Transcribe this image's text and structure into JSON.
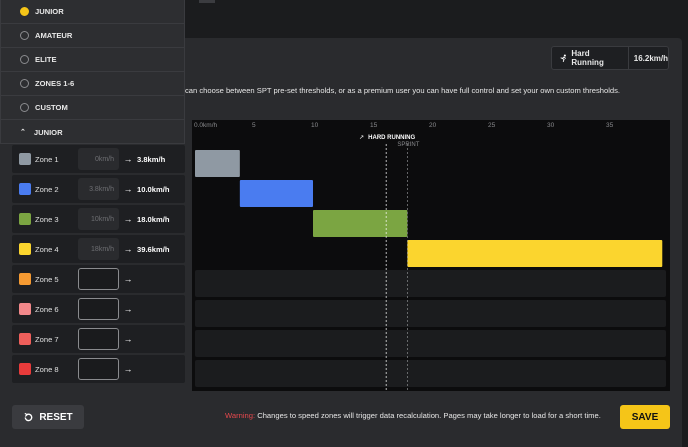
{
  "level_dropdown": {
    "options": [
      {
        "label": "JUNIOR",
        "selected": true
      },
      {
        "label": "AMATEUR",
        "selected": false
      },
      {
        "label": "ELITE",
        "selected": false
      },
      {
        "label": "ZONES 1-6",
        "selected": false
      },
      {
        "label": "CUSTOM",
        "selected": false
      }
    ],
    "current": "JUNIOR"
  },
  "hard_running": {
    "label": "Hard Running",
    "value": "16.2km/h"
  },
  "description": "can choose between SPT pre-set thresholds, or as a premium user you can have full control and set your own custom thresholds.",
  "zones": [
    {
      "name": "Zone 1",
      "color": "#8f99a3",
      "from": "0km/h",
      "to": "3.8km/h"
    },
    {
      "name": "Zone 2",
      "color": "#4a7cf0",
      "from": "3.8km/h",
      "to": "10.0km/h"
    },
    {
      "name": "Zone 3",
      "color": "#7ba542",
      "from": "10km/h",
      "to": "18.0km/h"
    },
    {
      "name": "Zone 4",
      "color": "#fbd52e",
      "from": "18km/h",
      "to": "39.6km/h"
    },
    {
      "name": "Zone 5",
      "color": "#f59a32",
      "from": "",
      "to": ""
    },
    {
      "name": "Zone 6",
      "color": "#f2888a",
      "from": "",
      "to": ""
    },
    {
      "name": "Zone 7",
      "color": "#ef5f5b",
      "from": "",
      "to": ""
    },
    {
      "name": "Zone 8",
      "color": "#e83b3b",
      "from": "",
      "to": ""
    }
  ],
  "chart_data": {
    "type": "bar",
    "x_ticks": [
      "0.0km/h",
      "5",
      "10",
      "15",
      "20",
      "25",
      "30",
      "35"
    ],
    "xlim": [
      0,
      40
    ],
    "bars": [
      {
        "zone": "Zone 1",
        "start": 0,
        "end": 3.8,
        "color": "#8f99a3"
      },
      {
        "zone": "Zone 2",
        "start": 3.8,
        "end": 10.0,
        "color": "#4a7cf0"
      },
      {
        "zone": "Zone 3",
        "start": 10.0,
        "end": 18.0,
        "color": "#7ba542"
      },
      {
        "zone": "Zone 4",
        "start": 18.0,
        "end": 39.6,
        "color": "#fbd52e"
      }
    ],
    "empty_rows": 4,
    "markers": [
      {
        "label": "HARD RUNNING",
        "value": 16.2
      },
      {
        "label": "SPRINT",
        "value": 18.0
      }
    ]
  },
  "footer": {
    "reset_label": "RESET",
    "warning_label": "Warning:",
    "warning_text": " Changes to speed zones will trigger data recalculation. Pages may take longer to load for a short time.",
    "save_label": "SAVE"
  }
}
